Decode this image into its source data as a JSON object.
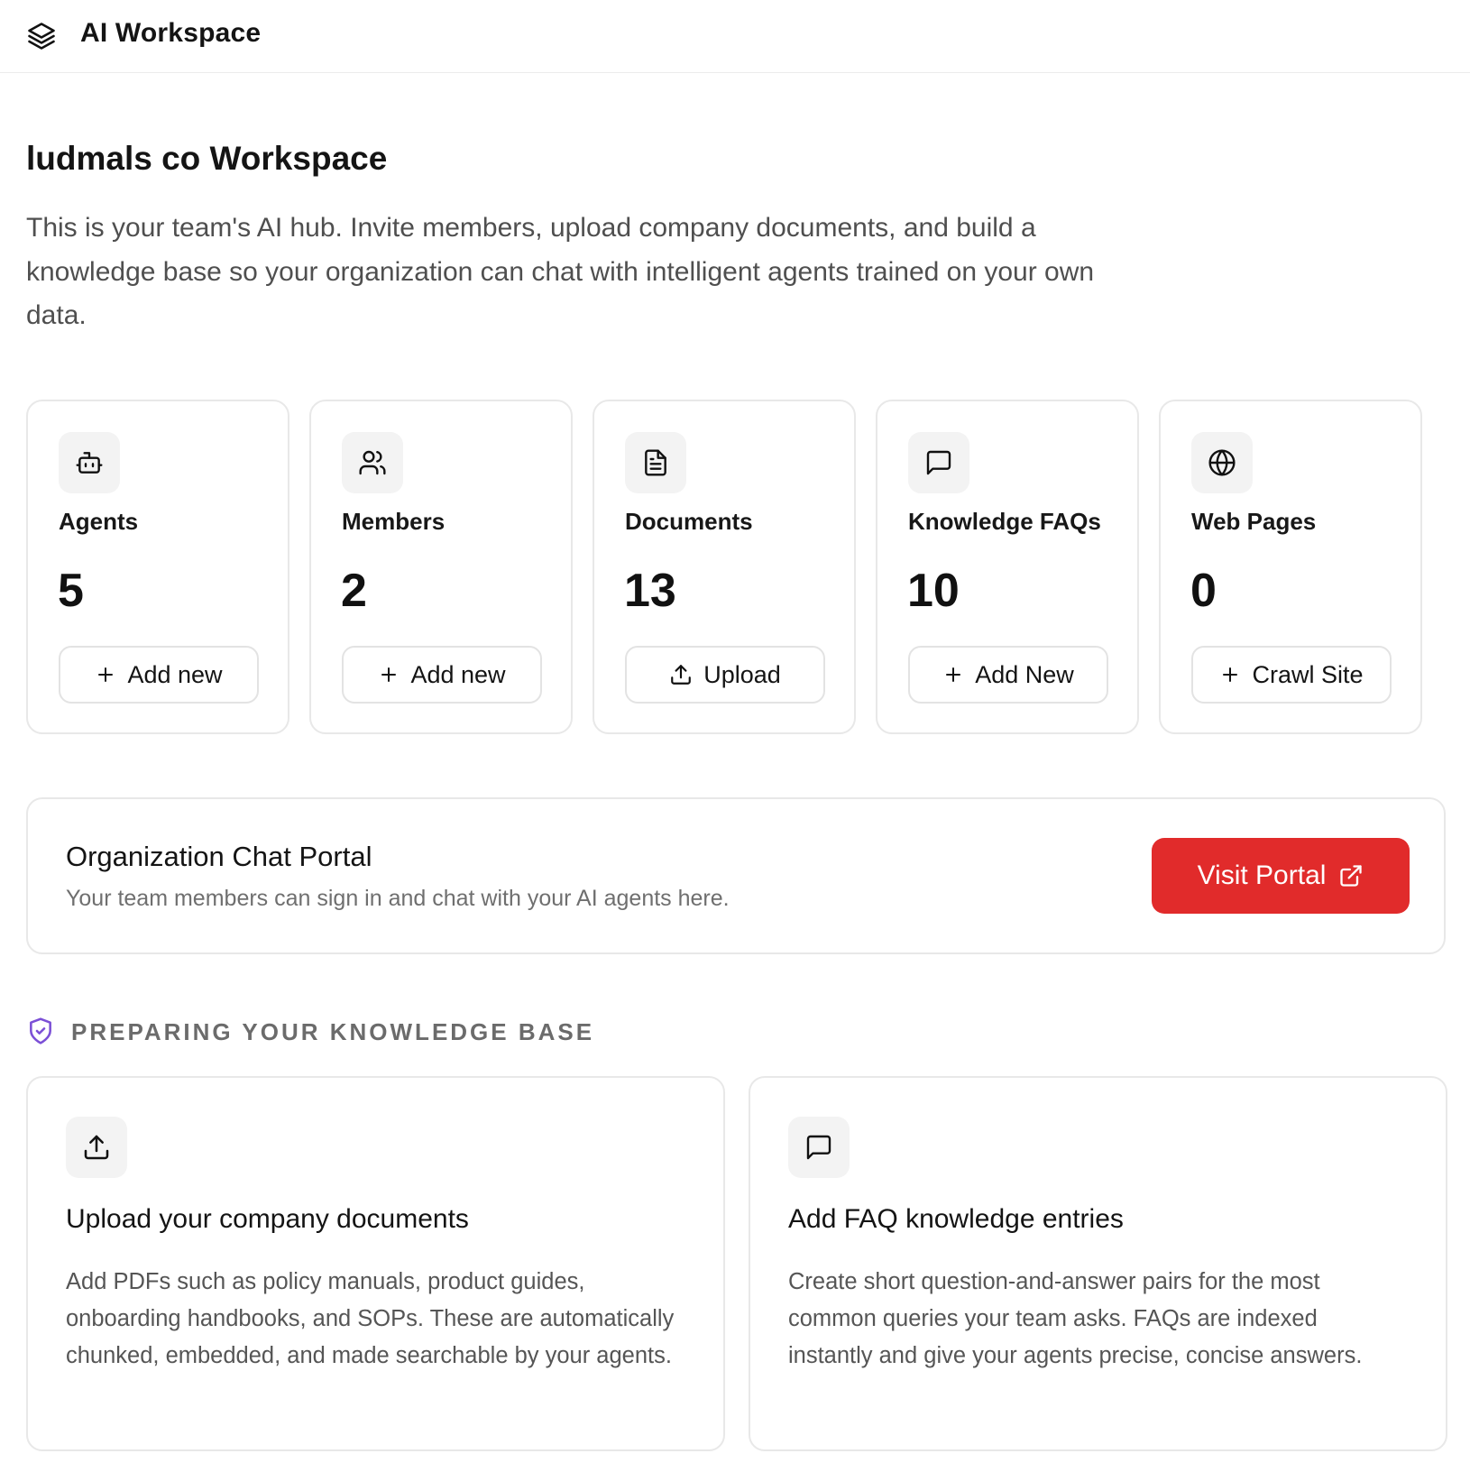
{
  "header": {
    "app_title": "AI Workspace",
    "icon": "layers-icon"
  },
  "workspace": {
    "title": "ludmals co Workspace",
    "description": "This is your team's AI hub. Invite members, upload company documents, and build a knowledge base so your organization can chat with intelligent agents trained on your own data."
  },
  "stats": [
    {
      "label": "Agents",
      "value": "5",
      "action": "Add new",
      "icon": "bot-icon",
      "action_icon": "plus-icon"
    },
    {
      "label": "Members",
      "value": "2",
      "action": "Add new",
      "icon": "users-icon",
      "action_icon": "plus-icon"
    },
    {
      "label": "Documents",
      "value": "13",
      "action": "Upload",
      "icon": "document-icon",
      "action_icon": "upload-icon"
    },
    {
      "label": "Knowledge FAQs",
      "value": "10",
      "action": "Add New",
      "icon": "message-square-icon",
      "action_icon": "plus-icon"
    },
    {
      "label": "Web Pages",
      "value": "0",
      "action": "Crawl Site",
      "icon": "globe-icon",
      "action_icon": "plus-icon"
    }
  ],
  "portal": {
    "title": "Organization Chat Portal",
    "subtitle": "Your team members can sign in and chat with your AI agents here.",
    "button_label": "Visit Portal",
    "button_icon": "external-link-icon",
    "button_color": "#e12b2b"
  },
  "knowledge_section": {
    "title": "PREPARING YOUR KNOWLEDGE BASE",
    "icon": "shield-check-icon",
    "icon_color": "#7b4fd6",
    "cards": [
      {
        "title": "Upload your company documents",
        "description": "Add PDFs such as policy manuals, product guides, onboarding handbooks, and SOPs. These are automatically chunked, embedded, and made searchable by your agents.",
        "icon": "upload-icon"
      },
      {
        "title": "Add FAQ knowledge entries",
        "description": "Create short question-and-answer pairs for the most common queries your team asks. FAQs are indexed instantly and give your agents precise, concise answers.",
        "icon": "message-square-icon"
      }
    ]
  }
}
